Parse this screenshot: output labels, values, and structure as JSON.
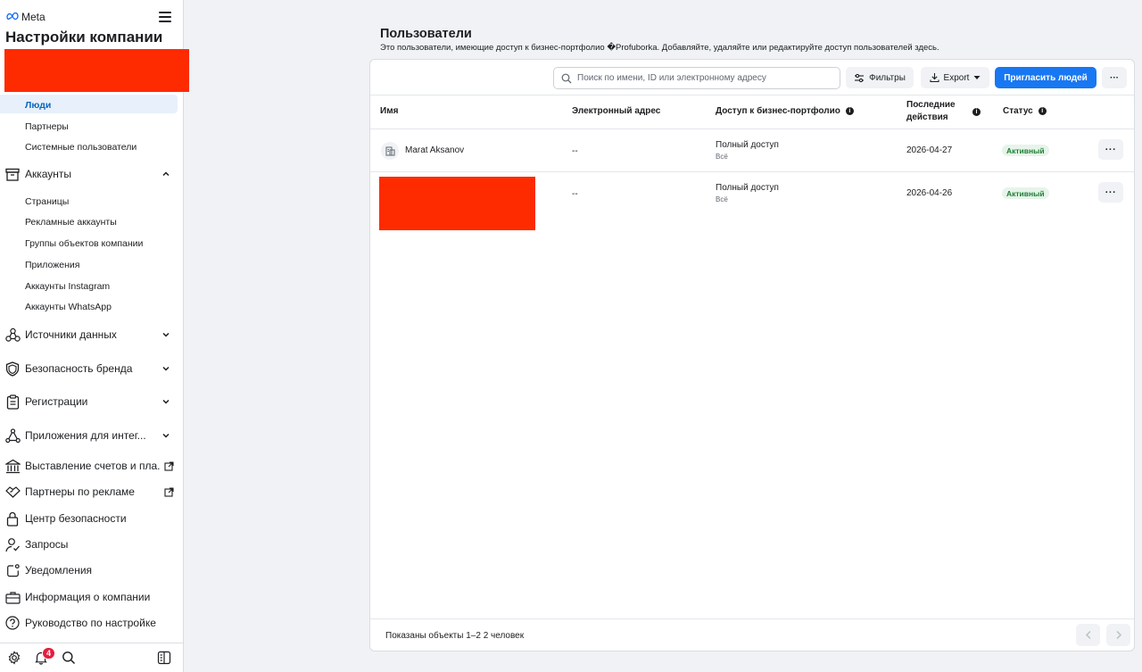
{
  "brand": {
    "name": "Meta"
  },
  "sidebar": {
    "title": "Настройки компании",
    "people_items": [
      {
        "label": "Люди",
        "active": true
      },
      {
        "label": "Партнеры"
      },
      {
        "label": "Системные пользователи"
      }
    ],
    "accounts": {
      "label": "Аккаунты",
      "items": [
        {
          "label": "Страницы"
        },
        {
          "label": "Рекламные аккаунты"
        },
        {
          "label": "Группы объектов компании"
        },
        {
          "label": "Приложения"
        },
        {
          "label": "Аккаунты Instagram"
        },
        {
          "label": "Аккаунты WhatsApp"
        }
      ]
    },
    "sections": [
      {
        "label": "Источники данных",
        "icon": "data-sources-icon"
      },
      {
        "label": "Безопасность бренда",
        "icon": "shield-icon"
      },
      {
        "label": "Регистрации",
        "icon": "clipboard-icon"
      },
      {
        "label": "Приложения для интег...",
        "icon": "integrations-icon"
      }
    ],
    "links": [
      {
        "label": "Выставление счетов и пла...",
        "icon": "bank-icon",
        "external": true
      },
      {
        "label": "Партнеры по рекламе",
        "icon": "handshake-icon",
        "external": true
      },
      {
        "label": "Центр безопасности",
        "icon": "lock-icon"
      },
      {
        "label": "Запросы",
        "icon": "person-check-icon"
      },
      {
        "label": "Уведомления",
        "icon": "notification-icon"
      },
      {
        "label": "Информация о компании",
        "icon": "briefcase-icon"
      },
      {
        "label": "Руководство по настройке",
        "icon": "question-icon"
      }
    ],
    "footer": {
      "notifications_count": "4"
    }
  },
  "main": {
    "title": "Пользователи",
    "subtitle": "Это пользователи, имеющие доступ к бизнес-портфолио �Profuborka. Добавляйте, удаляйте или редактируйте доступ пользователей здесь.",
    "toolbar": {
      "search_placeholder": "Поиск по имени, ID или электронному адресу",
      "filters_label": "Фильтры",
      "export_label": "Export",
      "invite_label": "Пригласить людей",
      "more_label": "···"
    },
    "table": {
      "headers": {
        "name": "Имя",
        "email": "Электронный адрес",
        "access": "Доступ к бизнес-портфолио",
        "last_activity_line1": "Последние",
        "last_activity_line2": "действия",
        "status": "Статус"
      },
      "rows": [
        {
          "name": "Marat Aksanov",
          "email": "--",
          "access": "Полный доступ",
          "access_sub": "Всё",
          "last_activity": "2026-04-27",
          "status": "Активный",
          "more": "···"
        },
        {
          "name": "",
          "email": "--",
          "access": "Полный доступ",
          "access_sub": "Всё",
          "last_activity": "2026-04-26",
          "status": "Активный",
          "more": "···"
        }
      ]
    },
    "footer": {
      "shown_text": "Показаны объекты 1–2 2 человек"
    }
  },
  "colors": {
    "accent": "#1877f2",
    "redaction": "#fe2b00",
    "active_nav": "#0a66c2",
    "status_green": "#1e7e34"
  }
}
